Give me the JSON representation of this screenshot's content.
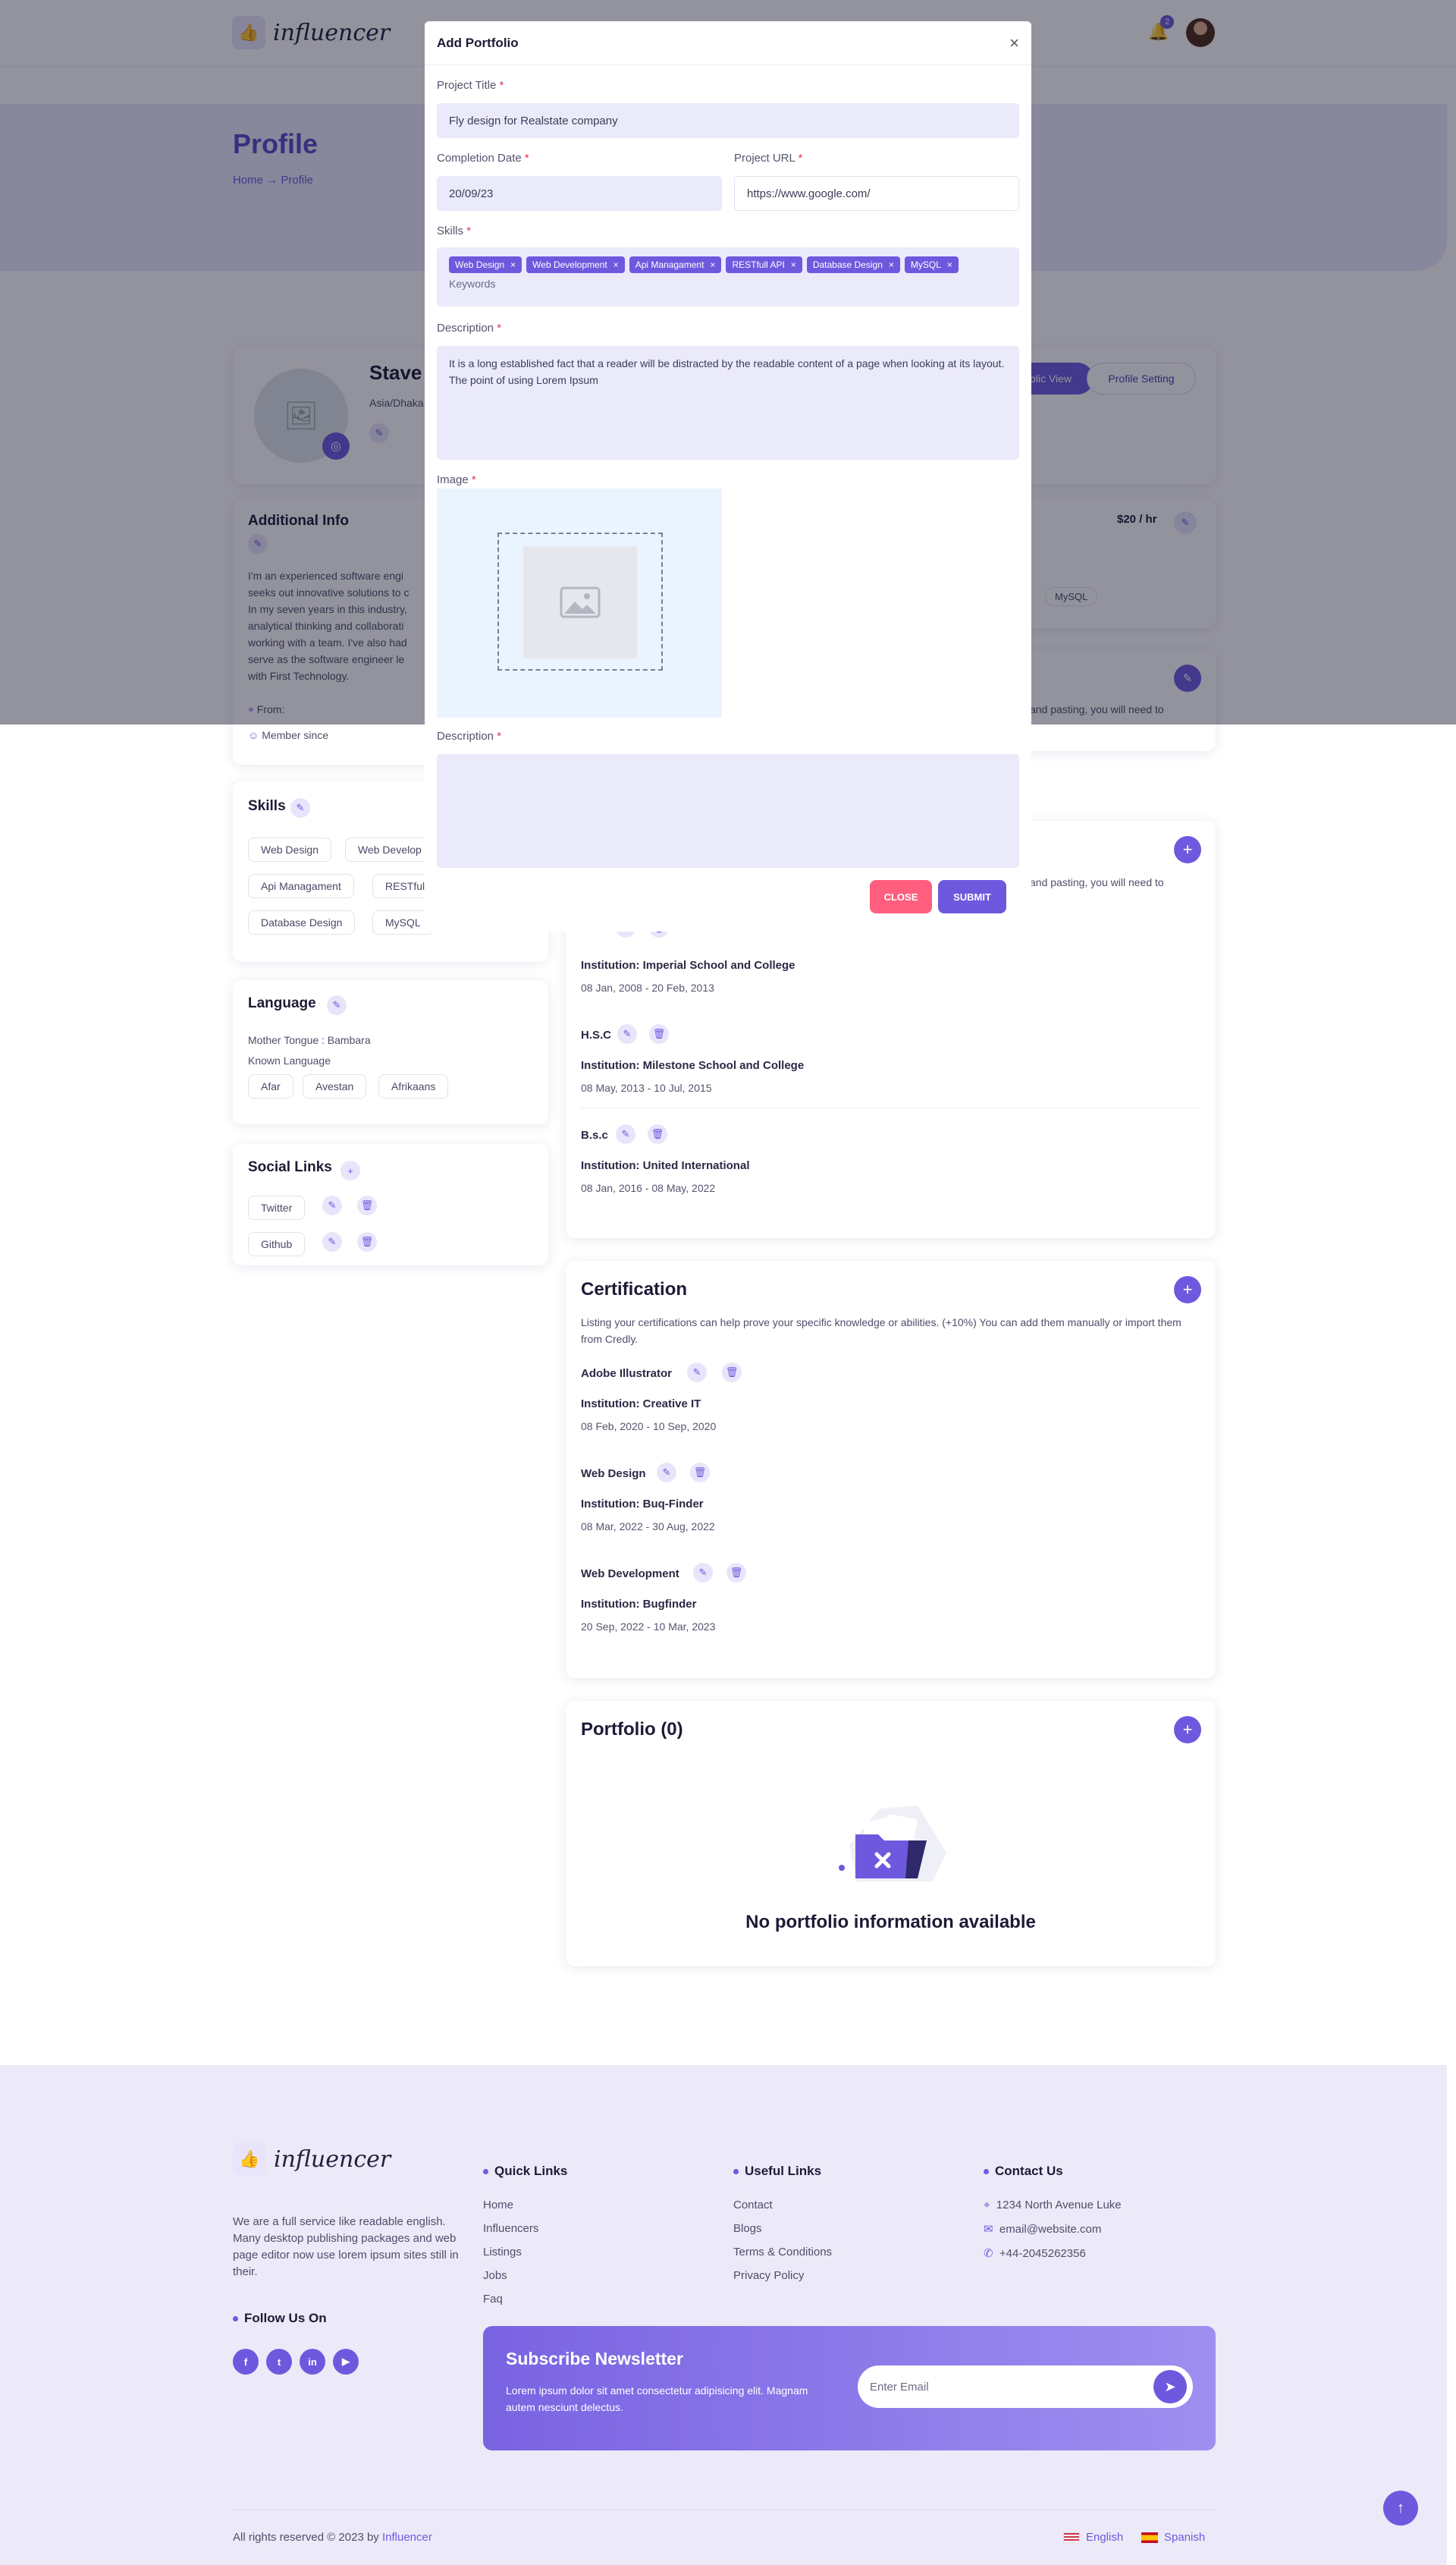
{
  "brand": {
    "name": "influencer"
  },
  "header": {
    "notif_count": "2"
  },
  "banner": {
    "title": "Profile",
    "crumb_home": "Home",
    "crumb_sep": "→",
    "crumb_current": "Profile"
  },
  "profile": {
    "name": "Stave",
    "location": "Asia/Dhaka",
    "rate": "$20 / hr",
    "public_view": "Public View",
    "profile_setting": "Profile Setting",
    "bio_tail": "and pasting, you will need to",
    "skills_shown": [
      "MySQL"
    ]
  },
  "additional": {
    "title": "Additional Info",
    "text": [
      "I'm an experienced software engi",
      "seeks out innovative solutions to c",
      "In my seven years in this industry,",
      "analytical thinking and collaborati",
      "working with a team. I've also had",
      "serve as the software engineer le",
      "with First Technology."
    ],
    "from": "From:",
    "member": "Member since"
  },
  "skills": {
    "title": "Skills",
    "items": [
      "Web Design",
      "Web Develop",
      "Api Managament",
      "RESTful",
      "Database Design",
      "MySQL"
    ]
  },
  "language": {
    "title": "Language",
    "mother": "Mother Tongue : Bambara",
    "known": "Known Language",
    "items": [
      "Afar",
      "Avestan",
      "Afrikaans"
    ]
  },
  "social": {
    "title": "Social Links",
    "items": [
      "Twitter",
      "Github"
    ]
  },
  "education": {
    "intro_tail": "and pasting, you will need to",
    "items": [
      {
        "degree": "",
        "institution": "Institution: Imperial School and College",
        "dates": "08 Jan, 2008 - 20 Feb, 2013"
      },
      {
        "degree": "H.S.C",
        "institution": "Institution: Milestone School and College",
        "dates": "08 May, 2013 - 10 Jul, 2015"
      },
      {
        "degree": "B.s.c",
        "institution": "Institution: United International",
        "dates": "08 Jan, 2016 - 08 May, 2022"
      }
    ]
  },
  "certification": {
    "title": "Certification",
    "intro": "Listing your certifications can help prove your specific knowledge or abilities. (+10%) You can add them manually or import them from Credly.",
    "items": [
      {
        "name": "Adobe Illustrator",
        "institution": "Institution: Creative IT",
        "dates": "08 Feb, 2020 - 10 Sep, 2020"
      },
      {
        "name": "Web Design",
        "institution": "Institution: Buq-Finder",
        "dates": "08 Mar, 2022 - 30 Aug, 2022"
      },
      {
        "name": "Web Development",
        "institution": "Institution: Bugfinder",
        "dates": "20 Sep, 2022 - 10 Mar, 2023"
      }
    ]
  },
  "portfolio": {
    "title": "Portfolio (0)",
    "empty": "No portfolio information available"
  },
  "modal": {
    "title": "Add Portfolio",
    "close_icon": "×",
    "project_title_label": "Project Title",
    "project_title_value": "Fly design for Realstate company",
    "completion_label": "Completion Date",
    "completion_value": "20/09/23",
    "url_label": "Project URL",
    "url_value": "https://www.google.com/",
    "skills_label": "Skills",
    "skills": [
      "Web Design",
      "Web Development",
      "Api Managament",
      "RESTfull API",
      "Database Design",
      "MySQL"
    ],
    "skills_placeholder": "Keywords",
    "desc_label": "Description",
    "desc_value": "It is a long established fact that a reader will be distracted by the readable content of a page when looking at its layout. The point of using Lorem Ipsum",
    "image_label": "Image",
    "desc2_label": "Description",
    "close_btn": "CLOSE",
    "submit_btn": "SUBMIT"
  },
  "footer": {
    "about": "We are a full service like readable english. Many desktop publishing packages and web page editor now use lorem ipsum sites still in their.",
    "follow": "Follow Us On",
    "socials": [
      "f",
      "t",
      "in",
      "▶"
    ],
    "quick_title": "Quick Links",
    "quick": [
      "Home",
      "Influencers",
      "Listings",
      "Jobs",
      "Faq"
    ],
    "useful_title": "Useful Links",
    "useful": [
      "Contact",
      "Blogs",
      "Terms & Conditions",
      "Privacy Policy"
    ],
    "contact_title": "Contact Us",
    "address": "1234 North Avenue Luke",
    "email": "email@website.com",
    "phone": "+44-2045262356",
    "newsletter_title": "Subscribe Newsletter",
    "newsletter_text": "Lorem ipsum dolor sit amet consectetur adipisicing elit. Magnam autem nesciunt delectus.",
    "email_placeholder": "Enter Email",
    "copyright": "All rights reserved © 2023 by",
    "copyright_brand": "Influencer",
    "lang_en": "English",
    "lang_es": "Spanish"
  },
  "colors": {
    "accent": "#6e59de",
    "danger": "#ff5e7e"
  }
}
